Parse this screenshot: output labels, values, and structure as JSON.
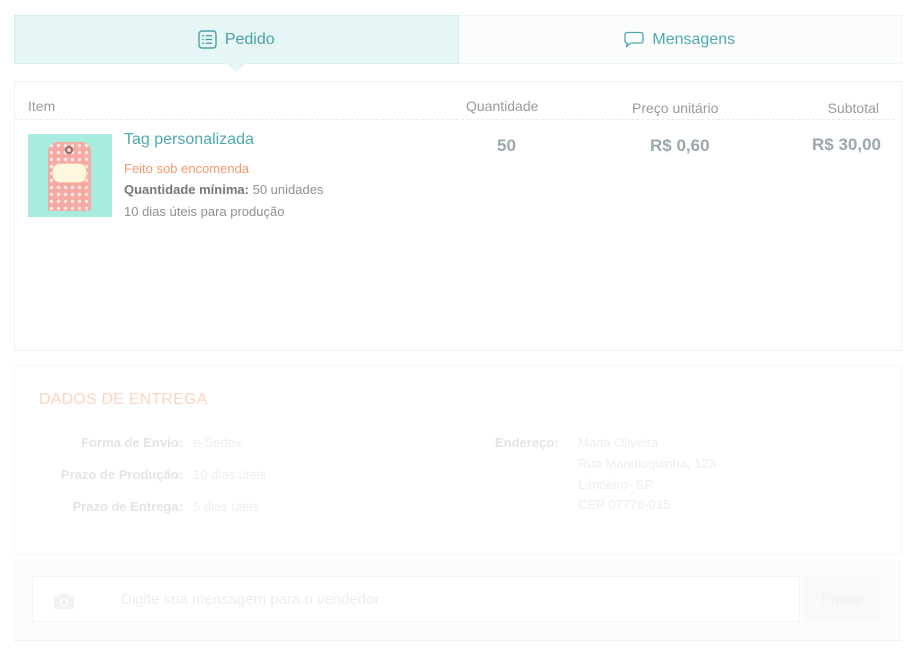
{
  "tabs": [
    {
      "label": "Pedido",
      "icon": "list-icon",
      "active": true
    },
    {
      "label": "Mensagens",
      "icon": "chat-bubble-icon",
      "active": false
    }
  ],
  "order": {
    "columns": {
      "item": "Item",
      "quantity": "Quantidade",
      "unit_price": "Preço unitário",
      "subtotal": "Subtotal"
    },
    "item": {
      "name": "Tag personalizada",
      "made_to_order": "Feito sob encomenda",
      "min_qty_label": "Quantidade mínima:",
      "min_qty_value": "50 unidades",
      "production_days": "10 dias úteis para produção",
      "quantity": "50",
      "unit_price": "R$ 0,60",
      "subtotal": "R$ 30,00"
    }
  },
  "delivery": {
    "title": "DADOS DE ENTREGA",
    "shipping_label": "Forma de Envio:",
    "shipping_value": "e-Sedex",
    "production_label": "Prazo de Produção:",
    "production_value": "10 dias úteis",
    "delivery_label": "Prazo de Entrega:",
    "delivery_value": "5 dias úteis",
    "address_label": "Endereço:",
    "address_lines": [
      "Maria Oliveira",
      "Rua Mandioquinha, 123",
      "Limoeiro- SP",
      "CEP 07776-015"
    ]
  },
  "message": {
    "placeholder": "Digite sua mensagem para o vendedor",
    "send_label": "Enviar"
  },
  "colors": {
    "accent": "#4fa8b0",
    "orange": "#f0996c",
    "tab_active_bg": "#e6f6f6"
  }
}
